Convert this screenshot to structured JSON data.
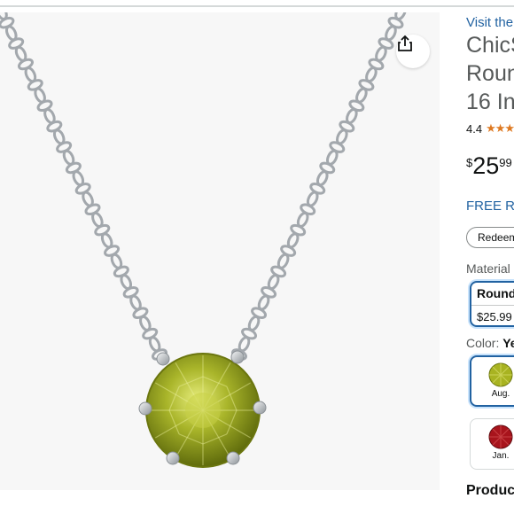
{
  "gallery": {
    "share_icon": "share-icon",
    "colors": {
      "gem": "#9aab1c",
      "gem_light": "#d4dd5a",
      "gem_dark": "#5f6b0c",
      "metal": "#a9aeb3"
    }
  },
  "product": {
    "visit_link": "Visit the",
    "title_lines": [
      "ChicS",
      "Roun",
      "16 In"
    ],
    "rating_value": "4.4",
    "rating_stars": "★★★",
    "price": {
      "symbol": "$",
      "whole": "25",
      "fraction": "99"
    },
    "free_returns": "FREE Ret",
    "redeem_label": "Redeem",
    "material": {
      "label": "Material",
      "selected_option": {
        "name": "Round",
        "price": "$25.99"
      }
    },
    "color": {
      "label": "Color: ",
      "selected_value": "Ye",
      "swatches": [
        {
          "label": "Aug.",
          "color": "#a8b321",
          "selected": true
        },
        {
          "label": "Jan.",
          "color": "#a8141c",
          "selected": false
        }
      ]
    },
    "section_heading": "Produc"
  },
  "theme": {
    "link": "#2162a1",
    "accent": "#de7921",
    "selected_border": "#2162a1"
  }
}
